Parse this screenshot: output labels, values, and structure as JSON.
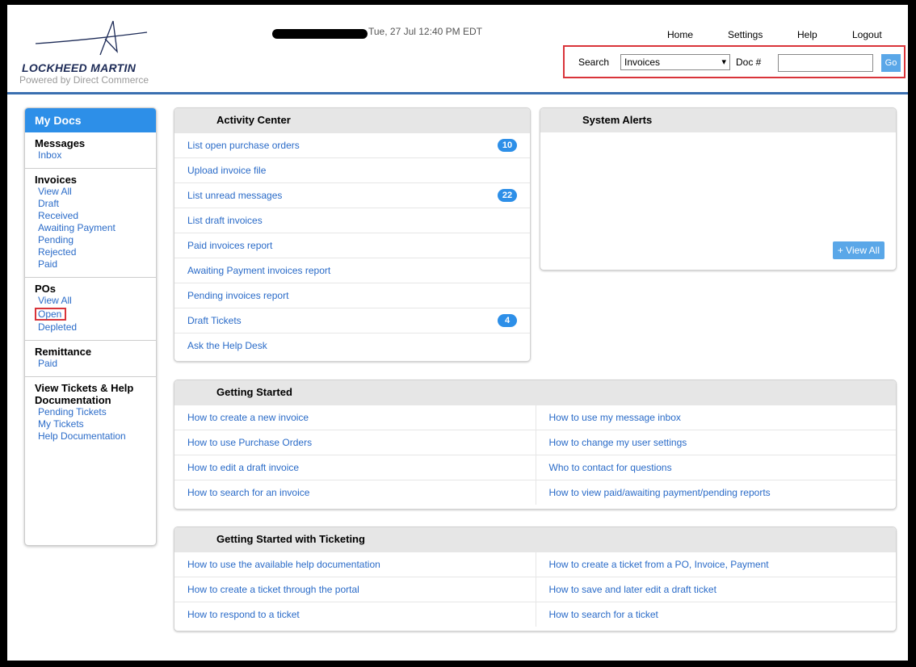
{
  "logo": {
    "name": "LOCKHEED MARTIN",
    "tagline": "Powered by Direct Commerce"
  },
  "header": {
    "datetime": "Tue, 27 Jul 12:40 PM EDT",
    "nav": [
      "Home",
      "Settings",
      "Help",
      "Logout"
    ]
  },
  "search": {
    "label": "Search",
    "selected": "Invoices",
    "doc_label": "Doc #",
    "doc_value": "",
    "go": "Go"
  },
  "sidebar": {
    "title": "My Docs",
    "sections": [
      {
        "title": "Messages",
        "links": [
          "Inbox"
        ]
      },
      {
        "title": "Invoices",
        "links": [
          "View All",
          "Draft",
          "Received",
          "Awaiting Payment",
          "Pending",
          "Rejected",
          "Paid"
        ]
      },
      {
        "title": "POs",
        "links": [
          "View All",
          "Open",
          "Depleted"
        ]
      },
      {
        "title": "Remittance",
        "links": [
          "Paid"
        ]
      },
      {
        "title": "View Tickets & Help Documentation",
        "links": [
          "Pending Tickets",
          "My Tickets",
          "Help Documentation"
        ]
      }
    ]
  },
  "activity": {
    "title": "Activity Center",
    "items": [
      {
        "label": "List open purchase orders",
        "badge": "10"
      },
      {
        "label": "Upload invoice file",
        "badge": ""
      },
      {
        "label": "List unread messages",
        "badge": "22"
      },
      {
        "label": "List draft invoices",
        "badge": ""
      },
      {
        "label": "Paid invoices report",
        "badge": ""
      },
      {
        "label": "Awaiting Payment invoices report",
        "badge": ""
      },
      {
        "label": "Pending invoices report",
        "badge": ""
      },
      {
        "label": "Draft Tickets",
        "badge": "4"
      },
      {
        "label": "Ask the Help Desk",
        "badge": ""
      }
    ]
  },
  "alerts": {
    "title": "System Alerts",
    "view_all": "+ View All"
  },
  "getting_started": {
    "title": "Getting Started",
    "rows": [
      [
        "How to create a new invoice",
        "How to use my message inbox"
      ],
      [
        "How to use Purchase Orders",
        "How to change my user settings"
      ],
      [
        "How to edit a draft invoice",
        "Who to contact for questions"
      ],
      [
        "How to search for an invoice",
        "How to view paid/awaiting payment/pending reports"
      ]
    ]
  },
  "ticketing": {
    "title": "Getting Started with Ticketing",
    "rows": [
      [
        "How to use the available help documentation",
        "How to create a ticket from a PO, Invoice, Payment"
      ],
      [
        "How to create a ticket through the portal",
        "How to save and later edit a draft ticket"
      ],
      [
        "How to respond to a ticket",
        "How to search for a ticket"
      ]
    ]
  }
}
